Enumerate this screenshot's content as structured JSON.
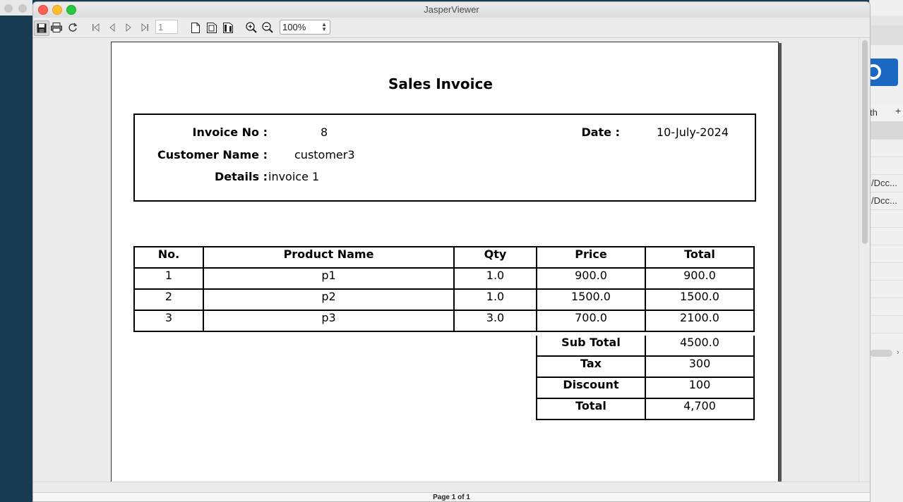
{
  "window": {
    "title": "JasperViewer"
  },
  "toolbar": {
    "page_number": "1",
    "zoom": "100%"
  },
  "icons": {
    "save": "save-icon",
    "print": "print-icon",
    "reload": "reload-icon",
    "first": "first-page-icon",
    "previous": "previous-page-icon",
    "next": "next-page-icon",
    "last": "last-page-icon",
    "actual_size": "actual-size-icon",
    "fit_page": "fit-page-icon",
    "fit_width": "fit-width-icon",
    "zoom_in": "zoom-in-icon",
    "zoom_out": "zoom-out-icon"
  },
  "report": {
    "title": "Sales Invoice",
    "invoice_no_label": "Invoice No :",
    "invoice_no": "8",
    "date_label": "Date :",
    "date": "10-July-2024",
    "customer_label": "Customer Name :",
    "customer": "customer3",
    "details_label": "Details :",
    "details": "invoice 1",
    "columns": [
      "No.",
      "Product Name",
      "Qty",
      "Price",
      "Total"
    ],
    "rows": [
      [
        "1",
        "p1",
        "1.0",
        "900.0",
        "900.0"
      ],
      [
        "2",
        "p2",
        "1.0",
        "1500.0",
        "1500.0"
      ],
      [
        "3",
        "p3",
        "3.0",
        "700.0",
        "2100.0"
      ]
    ],
    "summary": [
      {
        "label": "Sub Total",
        "value": "4500.0"
      },
      {
        "label": "Tax",
        "value": "300"
      },
      {
        "label": "Discount",
        "value": "100"
      },
      {
        "label": "Total",
        "value": "4,700"
      }
    ]
  },
  "status": {
    "page_info": "Page 1 of 1"
  },
  "background_window": {
    "header_fragment": "th",
    "row_fragments": [
      "/Dcc...",
      "/Dcc..."
    ]
  },
  "colors": {
    "accent_blue": "#1b68c2",
    "desktop": "#183a52"
  }
}
